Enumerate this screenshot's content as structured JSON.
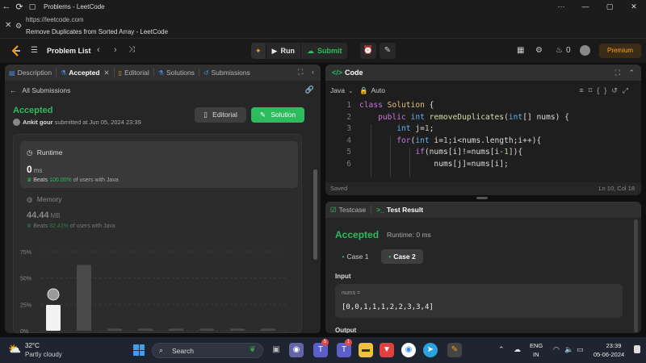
{
  "browser": {
    "tab_title": "Problems - LeetCode",
    "url": "https://leetcode.com",
    "page_title": "Remove Duplicates from Sorted Array - LeetCode"
  },
  "header": {
    "problem_list": "Problem List",
    "run": "Run",
    "submit": "Submit",
    "streak": "0",
    "premium": "Premium"
  },
  "left_tabs": [
    {
      "label": "Description"
    },
    {
      "label": "Accepted"
    },
    {
      "label": "Editorial"
    },
    {
      "label": "Solutions"
    },
    {
      "label": "Submissions"
    }
  ],
  "submission": {
    "back_label": "All Submissions",
    "status": "Accepted",
    "author": "Ankit gour",
    "submitted_text": "submitted at Jun 05, 2024 23:39",
    "editorial_btn": "Editorial",
    "solution_btn": "Solution",
    "runtime_label": "Runtime",
    "runtime_value": "0",
    "runtime_unit": "ms",
    "runtime_beats_prefix": "Beats",
    "runtime_beats_pct": "100.00%",
    "runtime_beats_suffix": "of users with Java",
    "memory_label": "Memory",
    "memory_value": "44.44",
    "memory_unit": "MB",
    "memory_beats_prefix": "Beats",
    "memory_beats_pct": "82.43%",
    "memory_beats_suffix": "of users with Java"
  },
  "chart_data": {
    "type": "bar",
    "y_ticks": [
      "75%",
      "50%",
      "25%",
      "0%"
    ],
    "ylim": [
      0,
      75
    ],
    "values": [
      24.5,
      62.5,
      2,
      2,
      2,
      2,
      2,
      2
    ],
    "highlight_index": 0
  },
  "code_panel": {
    "title": "Code",
    "language": "Java",
    "auto": "Auto",
    "saved": "Saved",
    "position": "Ln 10, Col 18",
    "lines": [
      {
        "n": "1",
        "text": "class Solution {"
      },
      {
        "n": "2",
        "text": "    public int removeDuplicates(int[] nums) {"
      },
      {
        "n": "3",
        "text": "        int j=1;"
      },
      {
        "n": "4",
        "text": "        for(int i=1;i<nums.length;i++){"
      },
      {
        "n": "5",
        "text": "            if(nums[i]!=nums[i-1]){"
      },
      {
        "n": "6",
        "text": "                nums[j]=nums[i];"
      }
    ]
  },
  "result_panel": {
    "testcase_tab": "Testcase",
    "result_tab": "Test Result",
    "status": "Accepted",
    "runtime_text": "Runtime: 0 ms",
    "case1": "Case 1",
    "case2": "Case 2",
    "input_label": "Input",
    "input_name": "nums =",
    "input_value": "[0,0,1,1,1,2,2,3,3,4]",
    "output_label": "Output"
  },
  "taskbar": {
    "temperature": "32°C",
    "weather": "Partly cloudy",
    "search": "Search",
    "lang_line1": "ENG",
    "lang_line2": "IN",
    "time": "23:39",
    "date": "05-06-2024",
    "badge_teams": "5",
    "badge_app": "1"
  }
}
